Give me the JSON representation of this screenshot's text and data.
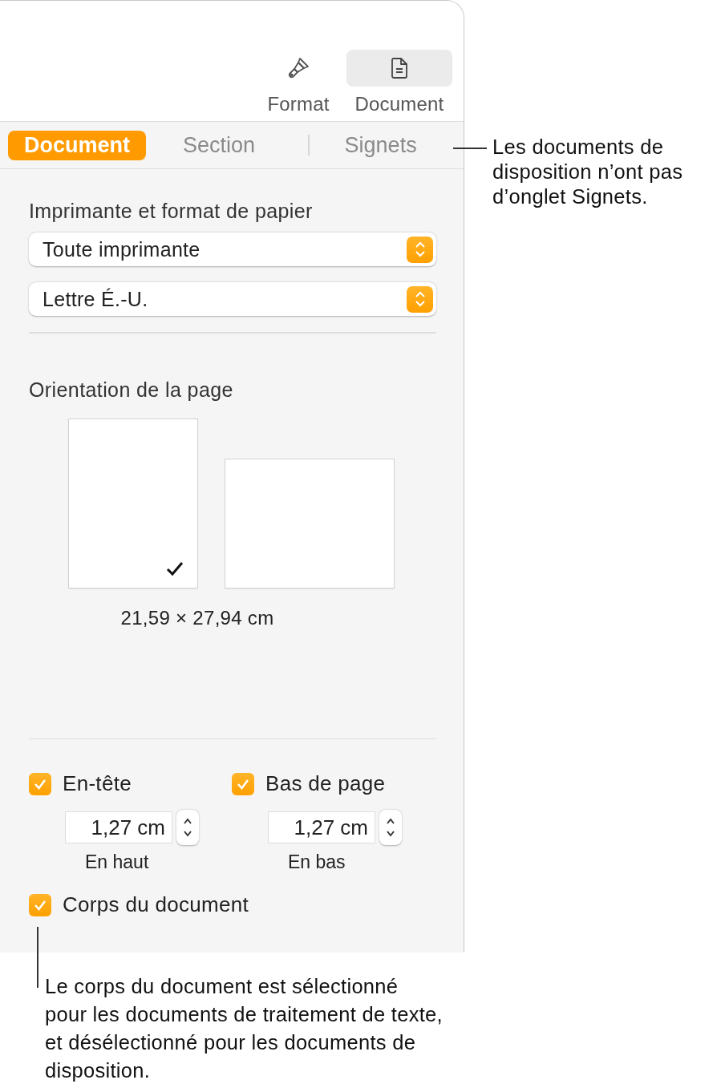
{
  "toolbar": [
    {
      "label": "Format",
      "kind": "brush",
      "selected": false
    },
    {
      "label": "Document",
      "kind": "document",
      "selected": true
    }
  ],
  "tabs": [
    {
      "label": "Document",
      "selected": true
    },
    {
      "label": "Section",
      "selected": false
    },
    {
      "label": "Signets",
      "selected": false
    }
  ],
  "paper": {
    "title": "Imprimante et format de papier",
    "popups": [
      "Toute imprimante",
      "Lettre É.-U."
    ]
  },
  "orientation": {
    "title": "Orientation de la page",
    "options": [
      {
        "kind": "portrait",
        "selected": true
      },
      {
        "kind": "landscape",
        "selected": false
      }
    ],
    "size": "21,59 × 27,94 cm"
  },
  "margins": [
    {
      "label": "En-tête",
      "checked": true,
      "value": "1,27 cm",
      "caption": "En haut"
    },
    {
      "label": "Bas de page",
      "checked": true,
      "value": "1,27 cm",
      "caption": "En bas"
    }
  ],
  "body": {
    "label": "Corps du document",
    "checked": true
  },
  "callouts": {
    "tabs_note": "Les documents de disposition n’ont pas d’onglet Signets.",
    "body_note": "Le corps du document est sélectionné pour les documents de traitement de texte, et désélectionné pour les documents de disposition."
  }
}
